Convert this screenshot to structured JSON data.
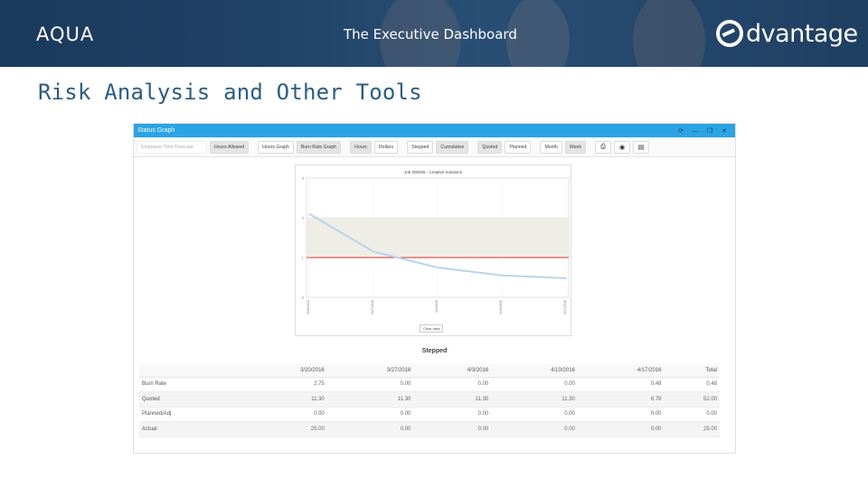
{
  "banner": {
    "brand": "AQUA",
    "title": "The Executive Dashboard",
    "logo_text": "dvantage",
    "colors": {
      "bg": "#2b4d72",
      "text": "#ffffff"
    }
  },
  "page_title": "Risk Analysis and Other Tools",
  "window": {
    "title": "Status Graph",
    "controls": [
      {
        "name": "refresh-icon",
        "glyph": "⟳"
      },
      {
        "name": "minimize-icon",
        "glyph": "—"
      },
      {
        "name": "restore-icon",
        "glyph": "❐"
      },
      {
        "name": "close-icon",
        "glyph": "✕"
      }
    ],
    "accent": "#2aa4e3"
  },
  "toolbar": {
    "employee_field": "Employee Time Forecast",
    "hours_allowed": "Hours Allowed",
    "hours_graph": "Hours Graph",
    "burn_rate_graph": "Burn Rate Graph",
    "hours": "Hours",
    "dollars": "Dollars",
    "stepped": "Stepped",
    "cumulative": "Cumulative",
    "quoted": "Quoted",
    "planned": "Planned",
    "month": "Month",
    "week": "Week",
    "icons": [
      "printer-icon",
      "export-icon",
      "document-icon"
    ]
  },
  "chart_data": {
    "type": "line",
    "title": "Job 000025 - Creative Solutions",
    "x": [
      "3/20/2016",
      "3/27/2016",
      "4/3/2016",
      "4/10/2016",
      "4/17/2016"
    ],
    "series": [
      {
        "values": [
          2.1,
          1.15,
          0.75,
          0.55,
          0.48
        ]
      }
    ],
    "reference_line": {
      "value": 1.0,
      "color": "#d9302c"
    },
    "band": {
      "from": 1.0,
      "to": 2.0
    },
    "yticks": [
      "3",
      "2",
      "1",
      "0"
    ],
    "ylim": [
      0,
      3
    ],
    "line_color": "#b9d4ea",
    "legend_button": "Clear data"
  },
  "mode_label": "Stepped",
  "table": {
    "columns": [
      "",
      "3/20/2016",
      "3/27/2016",
      "4/3/2016",
      "4/10/2016",
      "4/17/2016",
      "Total"
    ],
    "rows": [
      [
        "Burn Rate",
        "2.75",
        "0.00",
        "0.00",
        "0.00",
        "0.48",
        "0.48"
      ],
      [
        "Quoted",
        "11.30",
        "11.30",
        "11.30",
        "11.30",
        "6.78",
        "52.00"
      ],
      [
        "Planned/Adj",
        "0.00",
        "0.00",
        "0.00",
        "0.00",
        "0.00",
        "0.00"
      ],
      [
        "Actual",
        "25.00",
        "0.00",
        "0.00",
        "0.00",
        "0.00",
        "25.00"
      ]
    ]
  }
}
